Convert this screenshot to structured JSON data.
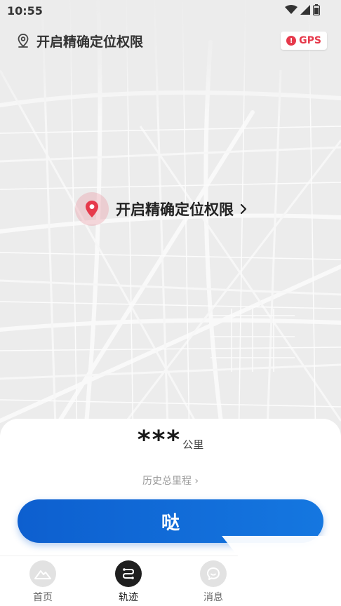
{
  "status_bar": {
    "time": "10:55"
  },
  "top_bar": {
    "title": "开启精确定位权限",
    "gps_badge": "GPS",
    "gps_alert": "!"
  },
  "map_prompt": {
    "text": "开启精确定位权限"
  },
  "sheet": {
    "distance_value": "***",
    "distance_unit": "公里",
    "history_link": "历史总里程 ›",
    "main_button": "哒"
  },
  "tabs": [
    {
      "label": "首页",
      "icon": "mountain-icon",
      "active": false
    },
    {
      "label": "轨迹",
      "icon": "route-icon",
      "active": true
    },
    {
      "label": "消息",
      "icon": "chat-icon",
      "active": false
    }
  ],
  "colors": {
    "accent": "#0d5fcf",
    "alert": "#e6394b",
    "map_bg": "#ececec"
  }
}
